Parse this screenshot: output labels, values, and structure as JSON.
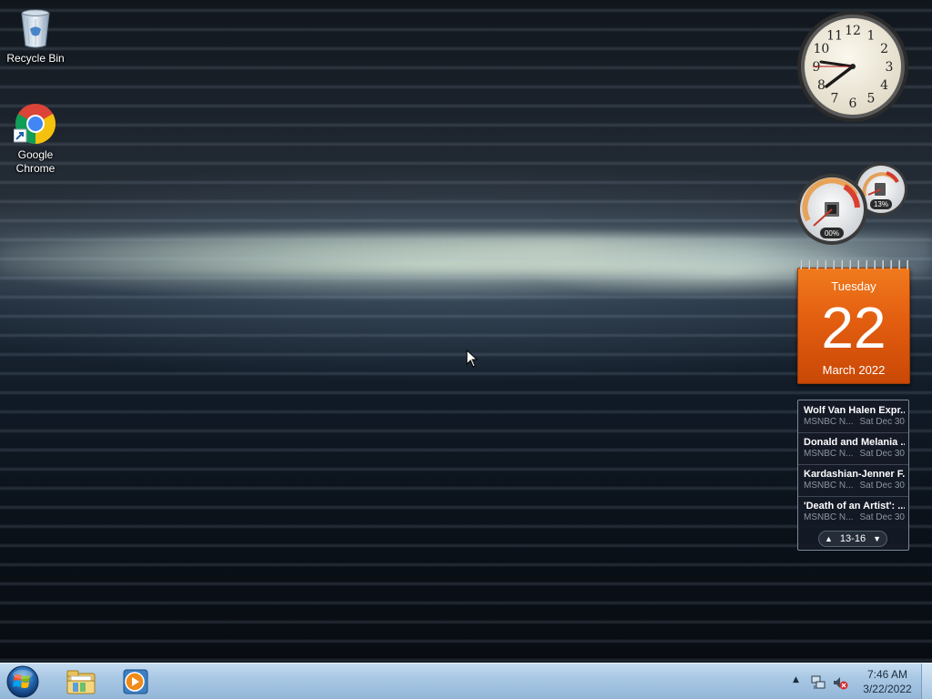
{
  "desktop": {
    "icons": [
      {
        "label": "Recycle Bin",
        "icon": "recycle-bin-icon"
      },
      {
        "label": "Google\nChrome",
        "icon": "chrome-icon"
      }
    ]
  },
  "gadgets": {
    "clock": {
      "numerals": [
        "12",
        "1",
        "2",
        "3",
        "4",
        "5",
        "6",
        "7",
        "8",
        "9",
        "10",
        "11"
      ],
      "time": "7:46"
    },
    "cpu_meter": {
      "cpu_percent": "00%",
      "memory_percent": "13%"
    },
    "calendar": {
      "weekday": "Tuesday",
      "day": "22",
      "month_year": "March 2022"
    },
    "feeds": {
      "items": [
        {
          "title": "Wolf Van Halen Expr...",
          "source": "MSNBC N...",
          "date": "Sat Dec 30"
        },
        {
          "title": "Donald and Melania ...",
          "source": "MSNBC N...",
          "date": "Sat Dec 30"
        },
        {
          "title": "Kardashian-Jenner F...",
          "source": "MSNBC N...",
          "date": "Sat Dec 30"
        },
        {
          "title": "'Death of an Artist': ...",
          "source": "MSNBC N...",
          "date": "Sat Dec 30"
        }
      ],
      "range": "13-16"
    }
  },
  "taskbar": {
    "start_icon": "windows-start-icon",
    "pinned": [
      "file-explorer-icon",
      "media-player-icon"
    ],
    "tray": {
      "time": "7:46 AM",
      "date": "3/22/2022"
    }
  }
}
